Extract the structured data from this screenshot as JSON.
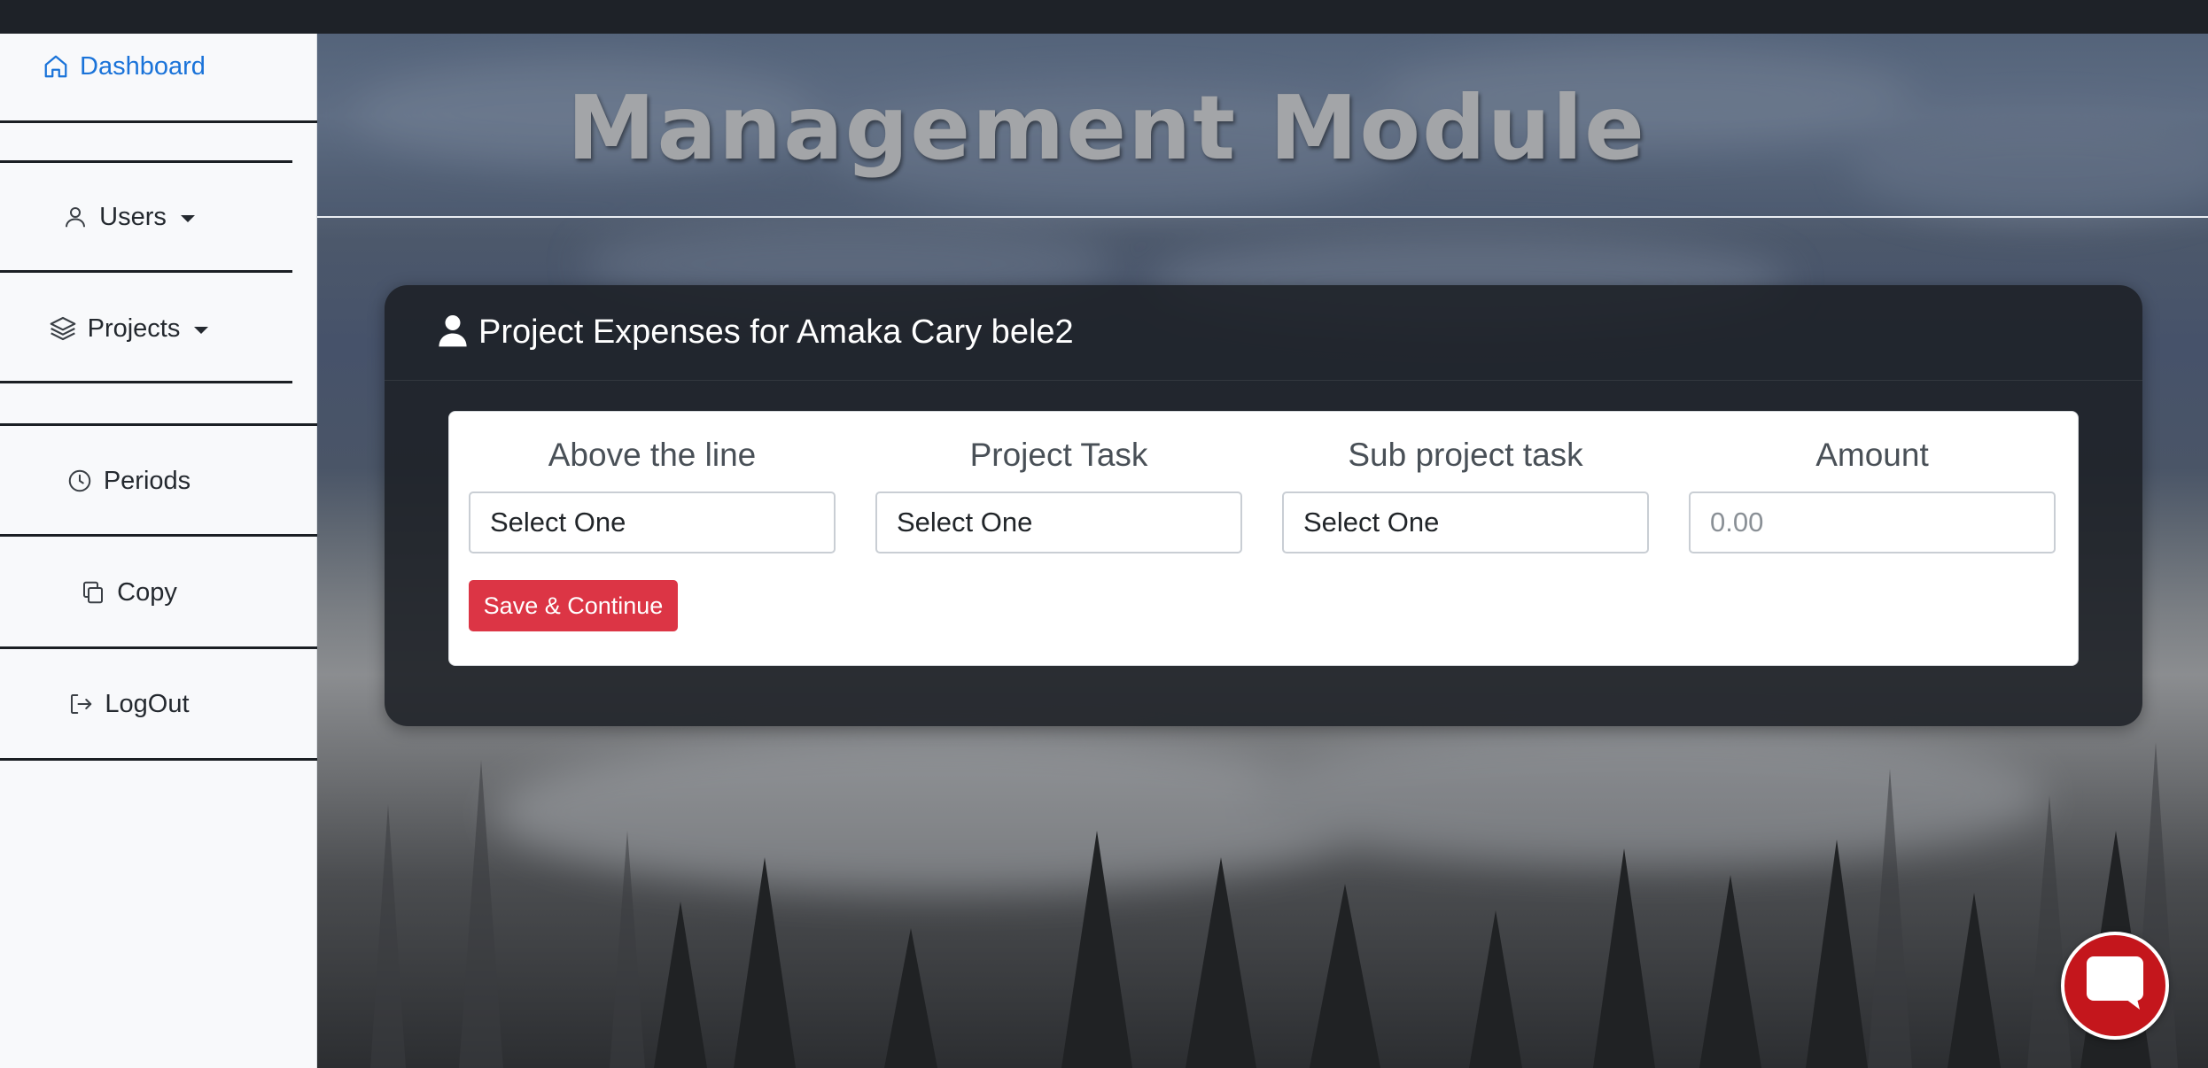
{
  "header": {
    "title": "Management Module"
  },
  "sidebar": {
    "items": [
      {
        "label": "Dashboard",
        "icon": "home-icon",
        "active": true
      },
      {
        "label": "Users",
        "icon": "user-icon",
        "dropdown": true
      },
      {
        "label": "Projects",
        "icon": "layers-icon",
        "dropdown": true
      },
      {
        "label": "Periods",
        "icon": "clock-icon"
      },
      {
        "label": "Copy",
        "icon": "copy-icon"
      },
      {
        "label": "LogOut",
        "icon": "logout-icon"
      }
    ]
  },
  "card": {
    "title": "Project Expenses for Amaka Cary bele2",
    "icon": "user-icon"
  },
  "form": {
    "fields": [
      {
        "label": "Above the line",
        "value": "Select One",
        "type": "select"
      },
      {
        "label": "Project Task",
        "value": "Select One",
        "type": "select"
      },
      {
        "label": "Sub project task",
        "value": "Select One",
        "type": "select"
      },
      {
        "label": "Amount",
        "placeholder": "0.00",
        "type": "input"
      }
    ],
    "save_label": "Save & Continue"
  },
  "chat": {
    "icon": "chat-bubble-icon"
  },
  "colors": {
    "accent": "#1a73d9",
    "danger": "#dc3545",
    "chat": "#c4161c",
    "topbar": "#1e2228"
  }
}
